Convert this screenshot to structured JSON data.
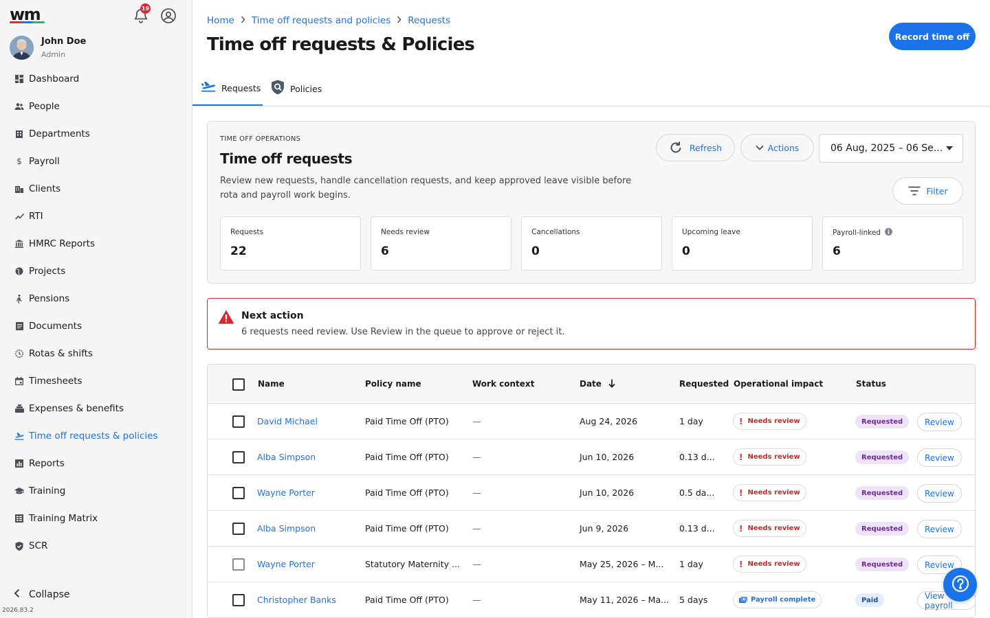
{
  "app": {
    "logo_text": "wm",
    "notifications_count": "19",
    "version": "2026.83.2"
  },
  "user": {
    "name": "John Doe",
    "role": "Admin"
  },
  "sidebar": {
    "items": [
      {
        "label": "Dashboard",
        "icon": "dashboard-icon"
      },
      {
        "label": "People",
        "icon": "people-icon"
      },
      {
        "label": "Departments",
        "icon": "building-icon"
      },
      {
        "label": "Payroll",
        "icon": "dollar-icon"
      },
      {
        "label": "Clients",
        "icon": "clients-icon"
      },
      {
        "label": "RTI",
        "icon": "trend-icon"
      },
      {
        "label": "HMRC Reports",
        "icon": "bank-icon"
      },
      {
        "label": "Projects",
        "icon": "globe-icon"
      },
      {
        "label": "Pensions",
        "icon": "walking-icon"
      },
      {
        "label": "Documents",
        "icon": "document-icon"
      },
      {
        "label": "Rotas & shifts",
        "icon": "clock-icon"
      },
      {
        "label": "Timesheets",
        "icon": "calendar-icon"
      },
      {
        "label": "Expenses & benefits",
        "icon": "expenses-icon"
      },
      {
        "label": "Time off requests & policies",
        "icon": "plane-icon",
        "active": true
      },
      {
        "label": "Reports",
        "icon": "report-icon"
      },
      {
        "label": "Training",
        "icon": "graduation-cap-icon"
      },
      {
        "label": "Training Matrix",
        "icon": "matrix-icon"
      },
      {
        "label": "SCR",
        "icon": "shield-check-icon"
      }
    ],
    "collapse_label": "Collapse"
  },
  "breadcrumb": [
    "Home",
    "Time off requests and policies",
    "Requests"
  ],
  "page": {
    "title": "Time off requests & Policies",
    "primary_button": "Record time off"
  },
  "tabs": [
    {
      "label": "Requests",
      "icon": "plane-icon",
      "active": true
    },
    {
      "label": "Policies",
      "icon": "shield-search-icon",
      "active": false
    }
  ],
  "operations": {
    "kicker": "TIME OFF OPERATIONS",
    "title": "Time off requests",
    "description": "Review new requests, handle cancellation requests, and keep approved leave visible before rota and payroll work begins.",
    "refresh_label": "Refresh",
    "actions_label": "Actions",
    "date_range": "06 Aug, 2025 – 06 Se...",
    "filter_label": "Filter",
    "stats": [
      {
        "label": "Requests",
        "value": "22"
      },
      {
        "label": "Needs review",
        "value": "6"
      },
      {
        "label": "Cancellations",
        "value": "0"
      },
      {
        "label": "Upcoming leave",
        "value": "0"
      },
      {
        "label": "Payroll-linked",
        "value": "6",
        "info": true
      }
    ]
  },
  "alert": {
    "title": "Next action",
    "message": "6 requests need review. Use Review in the queue to approve or reject it."
  },
  "table": {
    "columns": [
      "Name",
      "Policy name",
      "Work context",
      "Date",
      "Requested",
      "Operational impact",
      "Status"
    ],
    "rows": [
      {
        "name": "David Michael",
        "policy": "Paid Time Off (PTO)",
        "context": "—",
        "date": "Aug 24, 2026",
        "requested": "1 day",
        "impact": "Needs review",
        "status": "Requested",
        "action": "Review"
      },
      {
        "name": "Alba Simpson",
        "policy": "Paid Time Off (PTO)",
        "context": "—",
        "date": "Jun 10, 2026",
        "requested": "0.13 d...",
        "impact": "Needs review",
        "status": "Requested",
        "action": "Review"
      },
      {
        "name": "Wayne Porter",
        "policy": "Paid Time Off (PTO)",
        "context": "—",
        "date": "Jun 10, 2026",
        "requested": "0.5 da...",
        "impact": "Needs review",
        "status": "Requested",
        "action": "Review"
      },
      {
        "name": "Alba Simpson",
        "policy": "Paid Time Off (PTO)",
        "context": "—",
        "date": "Jun 9, 2026",
        "requested": "0.13 d...",
        "impact": "Needs review",
        "status": "Requested",
        "action": "Review"
      },
      {
        "name": "Wayne Porter",
        "policy": "Statutory Maternity ...",
        "context": "—",
        "date": "May 25, 2026 – M...",
        "requested": "1 day",
        "impact": "Needs review",
        "status": "Requested",
        "action": "Review"
      },
      {
        "name": "Christopher Banks",
        "policy": "Paid Time Off (PTO)",
        "context": "—",
        "date": "May 11, 2026 – Ma...",
        "requested": "5 days",
        "impact": "Payroll complete",
        "status": "Paid",
        "action": "View payroll"
      }
    ]
  },
  "colors": {
    "accent": "#1a73e8",
    "danger": "#d8272d",
    "status_requested_bg": "#efe3f8",
    "status_paid_bg": "#e3edfb"
  }
}
